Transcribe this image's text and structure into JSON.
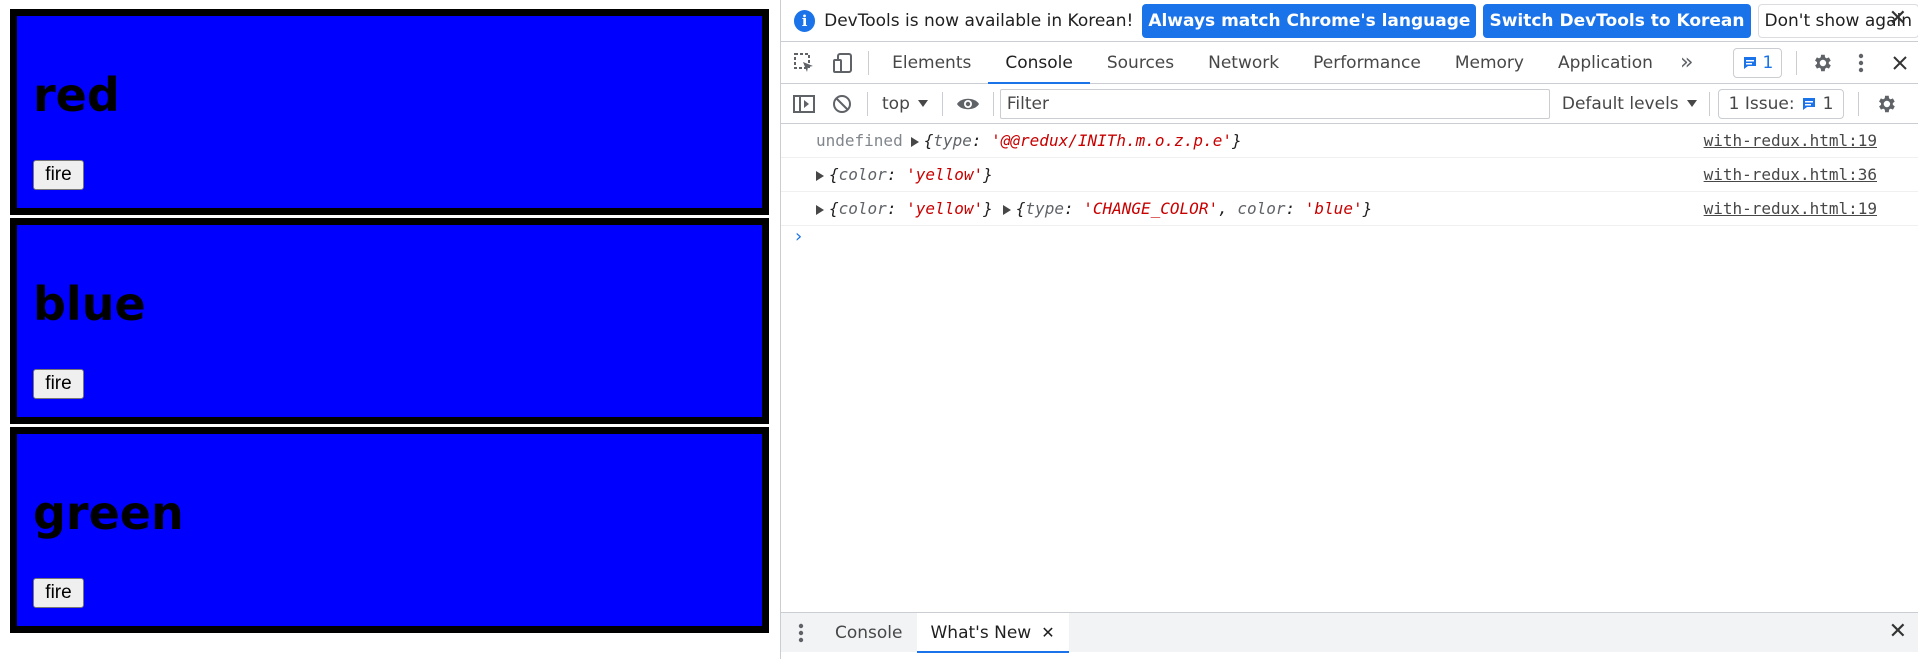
{
  "page": {
    "boxes": [
      {
        "heading": "red",
        "button": "fire"
      },
      {
        "heading": "blue",
        "button": "fire"
      },
      {
        "heading": "green",
        "button": "fire"
      }
    ],
    "box_color": "#0000ff"
  },
  "devtools": {
    "infobar": {
      "message": "DevTools is now available in Korean!",
      "btn_match": "Always match Chrome's language",
      "btn_switch": "Switch DevTools to Korean",
      "btn_dismiss": "Don't show again",
      "close": "✕"
    },
    "tabs": [
      "Elements",
      "Console",
      "Sources",
      "Network",
      "Performance",
      "Memory",
      "Application"
    ],
    "active_tab": "Console",
    "more": "»",
    "issue_badge_count": "1",
    "filterbar": {
      "context": "top",
      "filter_placeholder": "Filter",
      "levels": "Default levels",
      "issues_label": "1 Issue:",
      "issues_count": "1"
    },
    "console_rows": [
      {
        "prefix": "undefined",
        "parts": [
          {
            "k": "type",
            "v": "'@@redux/INITh.m.o.z.p.e'"
          }
        ],
        "source": "with-redux.html:19"
      },
      {
        "prefix": "",
        "parts": [
          {
            "k": "color",
            "v": "'yellow'"
          }
        ],
        "source": "with-redux.html:36"
      },
      {
        "prefix": "",
        "parts": [
          {
            "k": "color",
            "v": "'yellow'"
          }
        ],
        "parts2": [
          {
            "k": "type",
            "v": "'CHANGE_COLOR'"
          },
          {
            "k": "color",
            "v": "'blue'"
          }
        ],
        "source": "with-redux.html:19"
      }
    ],
    "prompt": "›",
    "drawer": {
      "tabs": [
        "Console",
        "What's New"
      ],
      "active": "What's New",
      "close": "✕"
    },
    "accent": "#1a73e8"
  }
}
